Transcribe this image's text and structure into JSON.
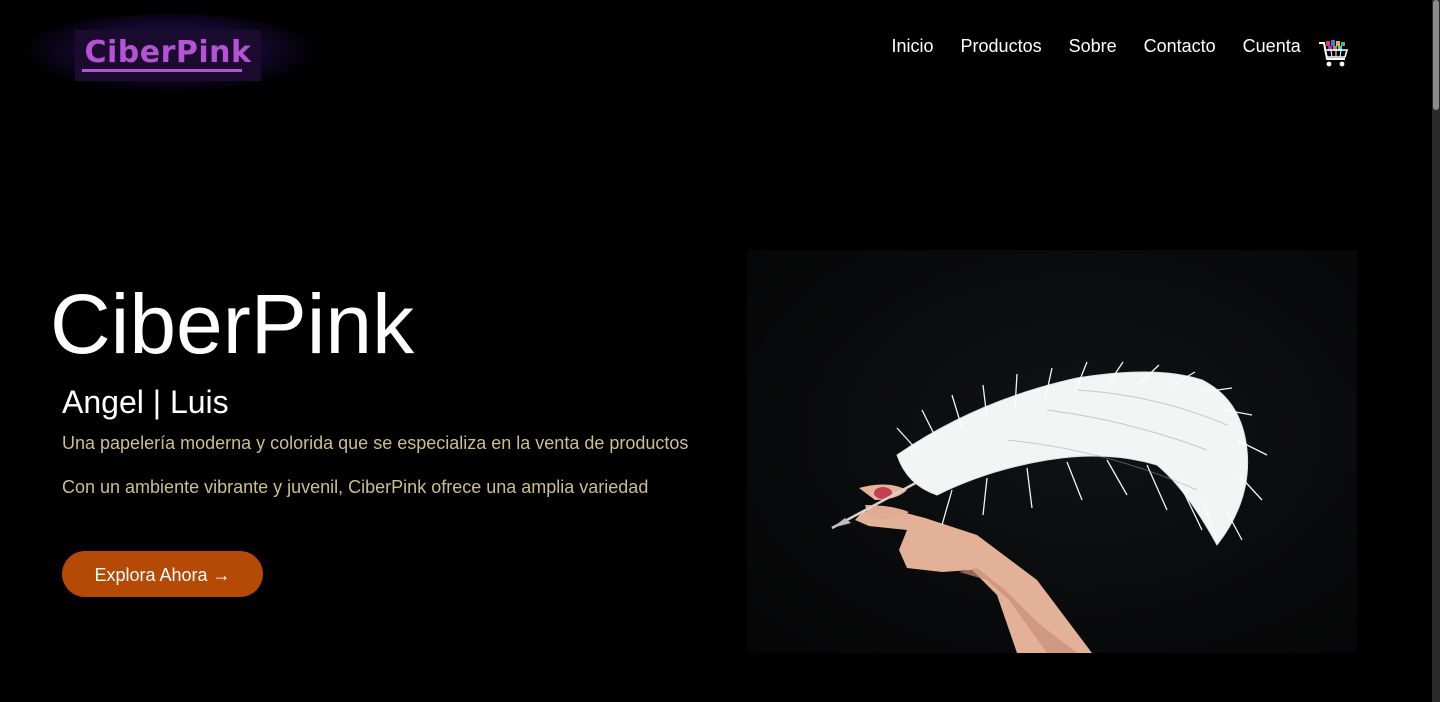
{
  "header": {
    "logo_text": "CiberPink",
    "nav": [
      "Inicio",
      "Productos",
      "Sobre",
      "Contacto",
      "Cuenta"
    ],
    "cart_icon": "cart-icon"
  },
  "hero": {
    "title": "CiberPink",
    "authors": "Angel | Luis",
    "line1": "Una papelería moderna y colorida que se especializa en la venta de productos",
    "line2": "Con un ambiente vibrante y juvenil, CiberPink ofrece una amplia variedad",
    "cta_label": "Explora Ahora →",
    "image_icon": "feather-quill-image"
  },
  "colors": {
    "background": "#000000",
    "logo_accent": "#b552d6",
    "body_text": "#cdbf8a",
    "cta_background": "#b54a07"
  }
}
